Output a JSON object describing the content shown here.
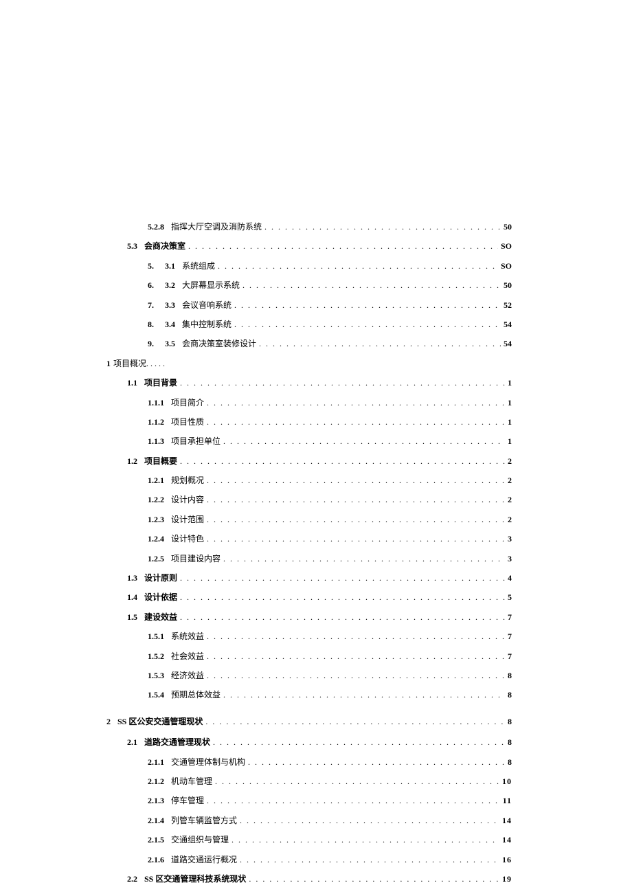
{
  "toc": [
    {
      "type": "sub2",
      "num": "5.2.8",
      "title": "指挥大厅空调及消防系统",
      "page": "50",
      "indent": 1,
      "bold_page": true
    },
    {
      "type": "sub1",
      "num": "5.3",
      "title": "会商决策室",
      "page": "SO",
      "indent": 0,
      "bold_all": true,
      "num_prefix": ""
    },
    {
      "type": "sub2_pair",
      "num1": "5.",
      "num2": "3.1",
      "title": "系统组成",
      "page": "SO",
      "indent": 1,
      "bold_page": true
    },
    {
      "type": "sub2_pair",
      "num1": "6.",
      "num2": "3.2",
      "title": "大屏幕显示系统",
      "page": "50",
      "indent": 1,
      "bold_page": true
    },
    {
      "type": "sub2_pair",
      "num1": "7.",
      "num2": "3.3",
      "title": "会议音响系统",
      "page": "52",
      "indent": 1,
      "bold_page": true
    },
    {
      "type": "sub2_pair",
      "num1": "8.",
      "num2": "3.4",
      "title": "集中控制系统",
      "page": "54",
      "indent": 1,
      "bold_page": true
    },
    {
      "type": "sub2_pair",
      "num1": "9.",
      "num2": "3.5",
      "title": "会商决策室装修设计",
      "page": "54",
      "indent": 1,
      "bold_page": true
    },
    {
      "type": "nodots",
      "num": "1",
      "title": "项目概况. . . . .",
      "page": "",
      "indent": -1
    },
    {
      "type": "sub1",
      "num": "1.1",
      "title": "项目背景",
      "page": "1",
      "indent": 0,
      "bold_all": true
    },
    {
      "type": "sub2",
      "num": "1.1.1",
      "title": "项目简介",
      "page": "1",
      "indent": 1,
      "bold_page": true
    },
    {
      "type": "sub2",
      "num": "1.1.2",
      "title": "项目性质",
      "page": "1",
      "indent": 1,
      "bold_page": true
    },
    {
      "type": "sub2",
      "num": "1.1.3",
      "title": "项目承担单位",
      "page": "1",
      "indent": 1,
      "bold_page": true
    },
    {
      "type": "sub1",
      "num": "1.2",
      "title": "项目概要",
      "page": "2",
      "indent": 0,
      "bold_all": true
    },
    {
      "type": "sub2",
      "num": "1.2.1",
      "title": "规划概况",
      "page": "2",
      "indent": 1,
      "bold_page": true
    },
    {
      "type": "sub2",
      "num": "1.2.2",
      "title": "设计内容",
      "page": "2",
      "indent": 1,
      "bold_page": true
    },
    {
      "type": "sub2",
      "num": "1.2.3",
      "title": "设计范围",
      "page": "2",
      "indent": 1,
      "bold_page": true
    },
    {
      "type": "sub2",
      "num": "1.2.4",
      "title": "设计特色",
      "page": "3",
      "indent": 1,
      "bold_page": true
    },
    {
      "type": "sub2",
      "num": "1.2.5",
      "title": "项目建设内容",
      "page": "3",
      "indent": 1,
      "bold_page": true
    },
    {
      "type": "sub1",
      "num": "1.3",
      "title": "设计原则",
      "page": "4",
      "indent": 0,
      "bold_all": true
    },
    {
      "type": "sub1",
      "num": "1.4",
      "title": "设计依据",
      "page": "5",
      "indent": 0,
      "bold_all": true
    },
    {
      "type": "sub1",
      "num": "1.5",
      "title": "建设效益",
      "page": "7",
      "indent": 0,
      "bold_all": true
    },
    {
      "type": "sub2",
      "num": "1.5.1",
      "title": "系统效益",
      "page": "7",
      "indent": 1,
      "bold_page": true
    },
    {
      "type": "sub2",
      "num": "1.5.2",
      "title": "社会效益",
      "page": "7",
      "indent": 1,
      "bold_page": true
    },
    {
      "type": "sub2",
      "num": "1.5.3",
      "title": "经济效益",
      "page": "8",
      "indent": 1,
      "bold_page": true
    },
    {
      "type": "sub2",
      "num": "1.5.4",
      "title": "预期总体效益",
      "page": "8",
      "indent": 1,
      "bold_page": true
    },
    {
      "type": "section",
      "num": "2",
      "title": "SS 区公安交通管理现状",
      "page": "8",
      "indent": -1,
      "bold_all": true,
      "gap": true
    },
    {
      "type": "sub1",
      "num": "2.1",
      "title": "道路交通管理现状",
      "page": "8",
      "indent": 0,
      "bold_all": true
    },
    {
      "type": "sub2",
      "num": "2.1.1",
      "title": "交通管理体制与机构",
      "page": "8",
      "indent": 1,
      "bold_page": true
    },
    {
      "type": "sub2",
      "num": "2.1.2",
      "title": "机动车管理",
      "page": "10",
      "indent": 1,
      "bold_page": true,
      "page_spaced": true
    },
    {
      "type": "sub2",
      "num": "2.1.3",
      "title": "停车管理",
      "page": "11",
      "indent": 1,
      "bold_page": true,
      "page_spaced": true
    },
    {
      "type": "sub2",
      "num": "2.1.4",
      "title": "列管车辆监管方式",
      "page": "14",
      "indent": 1,
      "bold_page": true,
      "page_spaced": true
    },
    {
      "type": "sub2",
      "num": "2.1.5",
      "title": "交通组织与管理",
      "page": "14",
      "indent": 1,
      "bold_page": true,
      "page_spaced": true
    },
    {
      "type": "sub2",
      "num": "2.1.6",
      "title": "道路交通运行概况",
      "page": "16",
      "indent": 1,
      "bold_page": true,
      "page_spaced": true
    },
    {
      "type": "sub1",
      "num": "2.2",
      "title": "SS 区交通管理科技系统现状",
      "page": "19",
      "indent": 0,
      "bold_all": true,
      "page_spaced": true,
      "title_with_dots": true
    }
  ],
  "dots": ". . . . . . . . . . . . . . . . . . . . . . . . . . . . . . . . . . . . . . . . . . . . . . . . . . . . . . . . . . . . . . . . . . . . . . . . . . . . . . . . . . . . . . . . . . . . . . . . . . . . . . . . . . . . . . . . . . . . ."
}
